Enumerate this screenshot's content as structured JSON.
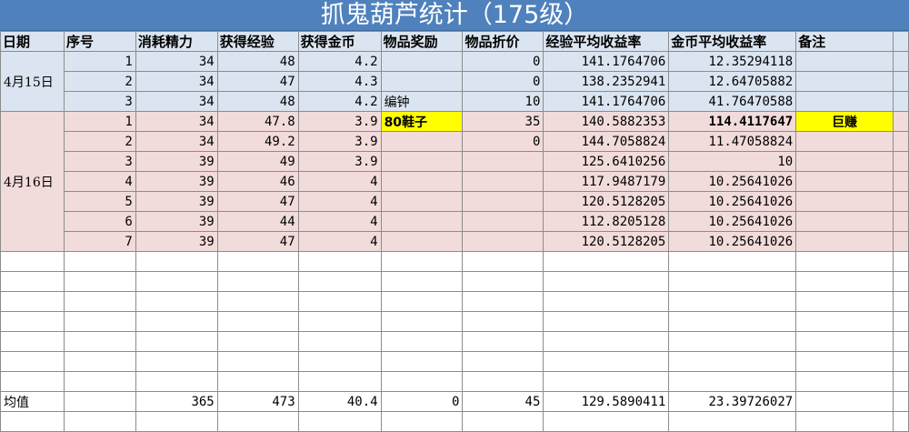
{
  "title": "抓鬼葫芦统计（175级）",
  "headers": [
    "日期",
    "序号",
    "消耗精力",
    "获得经验",
    "获得金币",
    "物品奖励",
    "物品折价",
    "经验平均收益率",
    "金币平均收益率",
    "备注"
  ],
  "groups": [
    {
      "date": "4月15日",
      "rows": [
        {
          "seq": "1",
          "energy": "34",
          "exp": "48",
          "gold": "4.2",
          "item": "",
          "price": "0",
          "exp_rate": "141.1764706",
          "gold_rate": "12.35294118",
          "note": ""
        },
        {
          "seq": "2",
          "energy": "34",
          "exp": "47",
          "gold": "4.3",
          "item": "",
          "price": "0",
          "exp_rate": "138.2352941",
          "gold_rate": "12.64705882",
          "note": ""
        },
        {
          "seq": "3",
          "energy": "34",
          "exp": "48",
          "gold": "4.2",
          "item": "编钟",
          "price": "10",
          "exp_rate": "141.1764706",
          "gold_rate": "41.76470588",
          "note": ""
        }
      ]
    },
    {
      "date": "4月16日",
      "rows": [
        {
          "seq": "1",
          "energy": "34",
          "exp": "47.8",
          "gold": "3.9",
          "item": "80鞋子",
          "price": "35",
          "exp_rate": "140.5882353",
          "gold_rate": "114.4117647",
          "note": "巨赚"
        },
        {
          "seq": "2",
          "energy": "34",
          "exp": "49.2",
          "gold": "3.9",
          "item": "",
          "price": "0",
          "exp_rate": "144.7058824",
          "gold_rate": "11.47058824",
          "note": ""
        },
        {
          "seq": "3",
          "energy": "39",
          "exp": "49",
          "gold": "3.9",
          "item": "",
          "price": "",
          "exp_rate": "125.6410256",
          "gold_rate": "10",
          "note": ""
        },
        {
          "seq": "4",
          "energy": "39",
          "exp": "46",
          "gold": "4",
          "item": "",
          "price": "",
          "exp_rate": "117.9487179",
          "gold_rate": "10.25641026",
          "note": ""
        },
        {
          "seq": "5",
          "energy": "39",
          "exp": "47",
          "gold": "4",
          "item": "",
          "price": "",
          "exp_rate": "120.5128205",
          "gold_rate": "10.25641026",
          "note": ""
        },
        {
          "seq": "6",
          "energy": "39",
          "exp": "44",
          "gold": "4",
          "item": "",
          "price": "",
          "exp_rate": "112.8205128",
          "gold_rate": "10.25641026",
          "note": ""
        },
        {
          "seq": "7",
          "energy": "39",
          "exp": "47",
          "gold": "4",
          "item": "",
          "price": "",
          "exp_rate": "120.5128205",
          "gold_rate": "10.25641026",
          "note": ""
        }
      ]
    }
  ],
  "summary": {
    "label": "均值",
    "energy": "365",
    "exp": "473",
    "gold": "40.4",
    "item": "0",
    "price": "45",
    "exp_rate": "129.5890411",
    "gold_rate": "23.39726027"
  },
  "colors": {
    "title_bg": "#4f81bd",
    "row_blue": "#dbe5f1",
    "row_pink": "#f2dcdb",
    "highlight": "#ffff00"
  }
}
